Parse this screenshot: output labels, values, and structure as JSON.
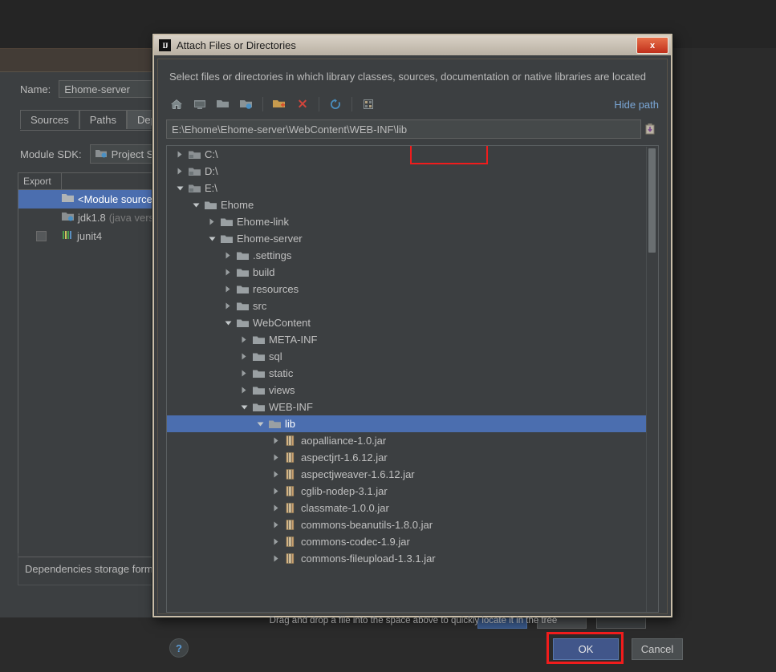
{
  "background_ide": {
    "name_label": "Name:",
    "name_value": "Ehome-server",
    "tabs": [
      {
        "label": "Sources",
        "active": false
      },
      {
        "label": "Paths",
        "active": false
      },
      {
        "label": "Depende",
        "active": true
      }
    ],
    "module_sdk_label": "Module SDK:",
    "module_sdk_value": "Project S",
    "table_header_export": "Export",
    "table_rows": [
      {
        "label": "<Module source",
        "selected": true,
        "icon": "folder-module-icon",
        "checkbox": false
      },
      {
        "label": "jdk1.8",
        "sublabel": "(java vers",
        "selected": false,
        "icon": "sdk-icon",
        "checkbox": false
      },
      {
        "label": "junit4",
        "sublabel": "",
        "selected": false,
        "icon": "library-icon",
        "checkbox": true
      }
    ],
    "dependencies_storage_label": "Dependencies storage form"
  },
  "dialog": {
    "app_icon": "IJ",
    "title": "Attach Files or Directories",
    "close_label": "x",
    "description": "Select files or directories in which library classes, sources, documentation or native libraries are located",
    "toolbar": [
      {
        "name": "home-icon",
        "glyph": "home"
      },
      {
        "name": "desktop-icon",
        "glyph": "desktop"
      },
      {
        "name": "project-folder-icon",
        "glyph": "folder-arrow"
      },
      {
        "name": "module-folder-icon",
        "glyph": "folder-blue"
      },
      {
        "name": "new-folder-icon",
        "glyph": "folder-new"
      },
      {
        "name": "delete-icon",
        "glyph": "x-red"
      },
      {
        "name": "refresh-icon",
        "glyph": "refresh"
      },
      {
        "name": "show-hidden-icon",
        "glyph": "hidden"
      }
    ],
    "hide_path_link": "Hide path",
    "path_value": "E:\\Ehome\\Ehome-server\\WebContent\\WEB-INF\\lib",
    "paste_icon": "paste-icon",
    "drag_drop_hint": "Drag and drop a file into the space above to quickly locate it in the tree",
    "help_label": "?",
    "ok_label": "OK",
    "cancel_label": "Cancel",
    "tree": [
      {
        "label": "C:\\",
        "depth": 0,
        "state": "collapsed",
        "icon": "drive-icon",
        "selected": false
      },
      {
        "label": "D:\\",
        "depth": 0,
        "state": "collapsed",
        "icon": "drive-icon",
        "selected": false
      },
      {
        "label": "E:\\",
        "depth": 0,
        "state": "expanded",
        "icon": "drive-icon",
        "selected": false
      },
      {
        "label": "Ehome",
        "depth": 1,
        "state": "expanded",
        "icon": "folder-icon",
        "selected": false
      },
      {
        "label": "Ehome-link",
        "depth": 2,
        "state": "collapsed",
        "icon": "folder-icon",
        "selected": false
      },
      {
        "label": "Ehome-server",
        "depth": 2,
        "state": "expanded",
        "icon": "folder-icon",
        "selected": false
      },
      {
        "label": ".settings",
        "depth": 3,
        "state": "collapsed",
        "icon": "folder-icon",
        "selected": false
      },
      {
        "label": "build",
        "depth": 3,
        "state": "collapsed",
        "icon": "folder-icon",
        "selected": false
      },
      {
        "label": "resources",
        "depth": 3,
        "state": "collapsed",
        "icon": "folder-icon",
        "selected": false
      },
      {
        "label": "src",
        "depth": 3,
        "state": "collapsed",
        "icon": "folder-icon",
        "selected": false
      },
      {
        "label": "WebContent",
        "depth": 3,
        "state": "expanded",
        "icon": "folder-icon",
        "selected": false
      },
      {
        "label": "META-INF",
        "depth": 4,
        "state": "collapsed",
        "icon": "folder-icon",
        "selected": false
      },
      {
        "label": "sql",
        "depth": 4,
        "state": "collapsed",
        "icon": "folder-icon",
        "selected": false
      },
      {
        "label": "static",
        "depth": 4,
        "state": "collapsed",
        "icon": "folder-icon",
        "selected": false
      },
      {
        "label": "views",
        "depth": 4,
        "state": "collapsed",
        "icon": "folder-icon",
        "selected": false
      },
      {
        "label": "WEB-INF",
        "depth": 4,
        "state": "expanded",
        "icon": "folder-icon",
        "selected": false
      },
      {
        "label": "lib",
        "depth": 5,
        "state": "expanded",
        "icon": "folder-icon",
        "selected": true
      },
      {
        "label": "aopalliance-1.0.jar",
        "depth": 6,
        "state": "collapsed",
        "icon": "jar-icon",
        "selected": false
      },
      {
        "label": "aspectjrt-1.6.12.jar",
        "depth": 6,
        "state": "collapsed",
        "icon": "jar-icon",
        "selected": false
      },
      {
        "label": "aspectjweaver-1.6.12.jar",
        "depth": 6,
        "state": "collapsed",
        "icon": "jar-icon",
        "selected": false
      },
      {
        "label": "cglib-nodep-3.1.jar",
        "depth": 6,
        "state": "collapsed",
        "icon": "jar-icon",
        "selected": false
      },
      {
        "label": "classmate-1.0.0.jar",
        "depth": 6,
        "state": "collapsed",
        "icon": "jar-icon",
        "selected": false
      },
      {
        "label": "commons-beanutils-1.8.0.jar",
        "depth": 6,
        "state": "collapsed",
        "icon": "jar-icon",
        "selected": false
      },
      {
        "label": "commons-codec-1.9.jar",
        "depth": 6,
        "state": "collapsed",
        "icon": "jar-icon",
        "selected": false
      },
      {
        "label": "commons-fileupload-1.3.1.jar",
        "depth": 6,
        "state": "collapsed",
        "icon": "jar-icon",
        "selected": false
      }
    ]
  },
  "colors": {
    "selection_blue": "#4b6eaf",
    "highlight_red": "#f01c1c",
    "link_blue": "#7ba7d7",
    "dialog_bg": "#3c3f41",
    "titlebar": "#cfc7ba"
  }
}
